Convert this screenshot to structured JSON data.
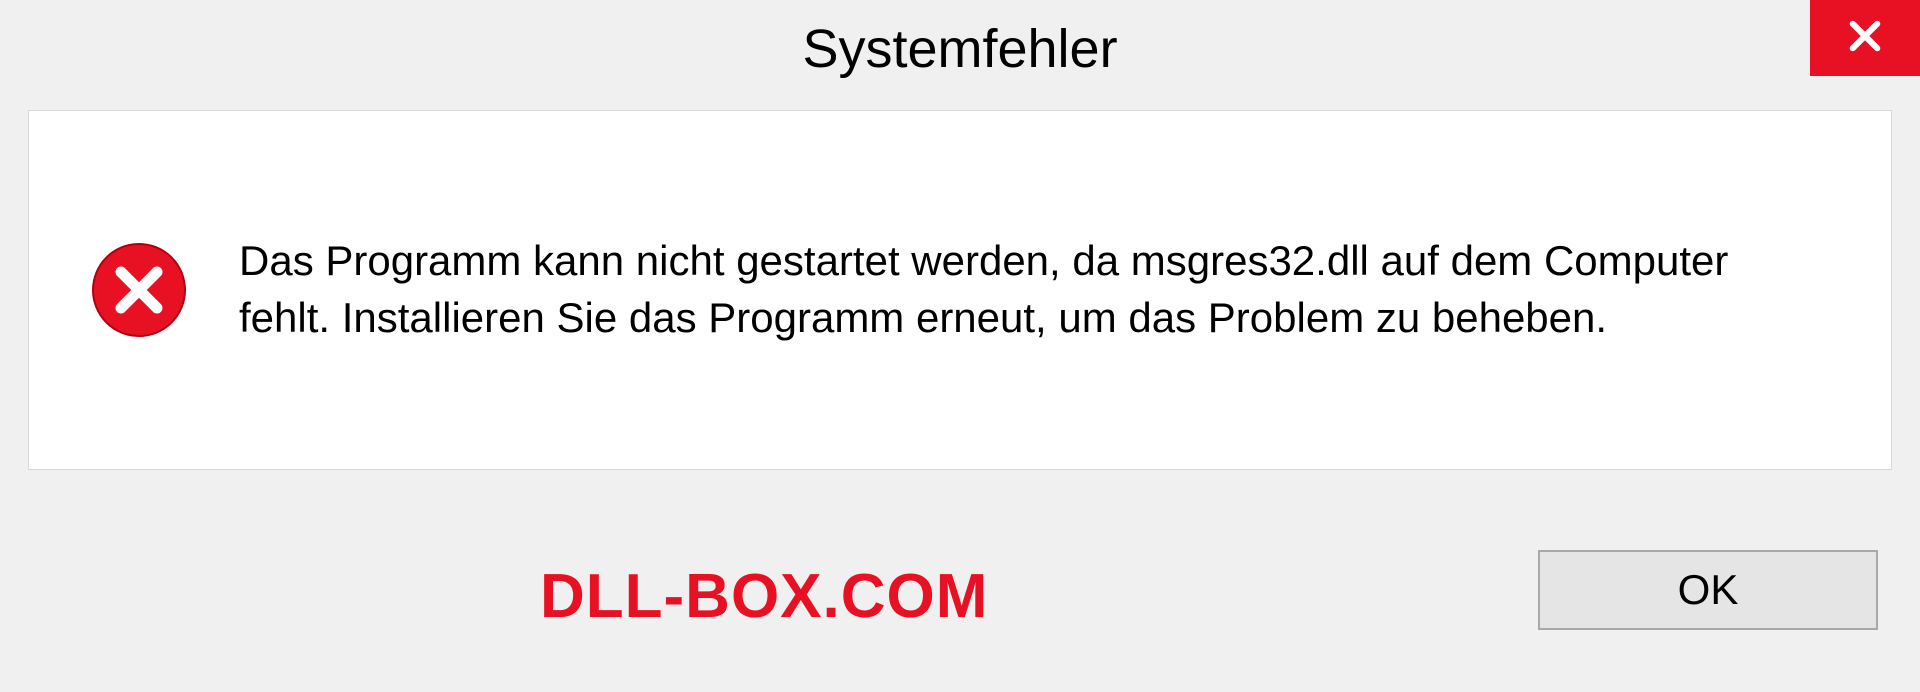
{
  "dialog": {
    "title": "Systemfehler",
    "message": "Das Programm kann nicht gestartet werden, da msgres32.dll auf dem Computer fehlt. Installieren Sie das Programm erneut, um das Problem zu beheben.",
    "ok_label": "OK"
  },
  "watermark": "DLL-BOX.COM",
  "colors": {
    "close_bg": "#e81123",
    "error_icon": "#e81123",
    "watermark": "#e81123"
  }
}
